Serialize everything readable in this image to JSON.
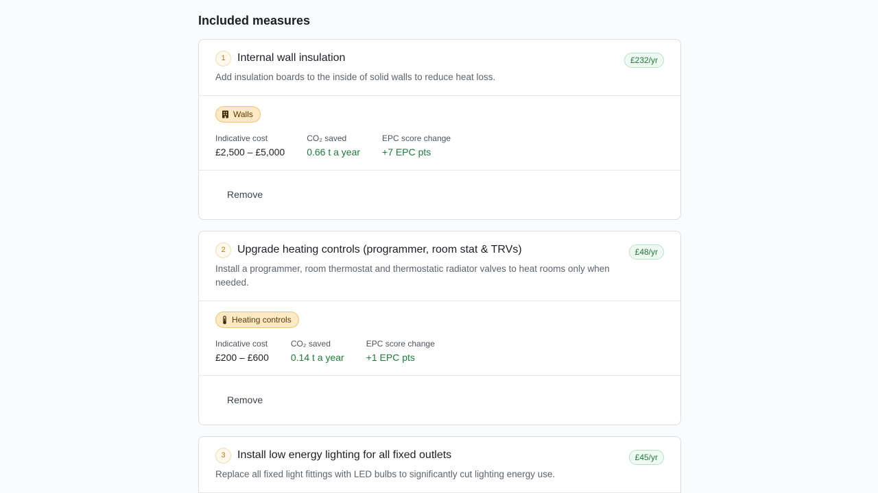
{
  "section": {
    "title": "Included measures"
  },
  "measures": [
    {
      "number": "1",
      "title": "Internal wall insulation",
      "description": "Add insulation boards to the inside of solid walls to reduce heat loss.",
      "savings": "£232/yr",
      "category": {
        "label": "Walls",
        "icon": "building-icon"
      },
      "metrics": {
        "cost_label": "Indicative cost",
        "cost_value": "£2,500 – £5,000",
        "co2_label": "CO₂ saved",
        "co2_value": "0.66 t a year",
        "epc_label": "EPC score change",
        "epc_value": "+7 EPC pts"
      },
      "remove_label": "Remove"
    },
    {
      "number": "2",
      "title": "Upgrade heating controls (programmer, room stat & TRVs)",
      "description": "Install a programmer, room thermostat and thermostatic radiator valves to heat rooms only when needed.",
      "savings": "£48/yr",
      "category": {
        "label": "Heating controls",
        "icon": "thermometer-icon"
      },
      "metrics": {
        "cost_label": "Indicative cost",
        "cost_value": "£200 – £600",
        "co2_label": "CO₂ saved",
        "co2_value": "0.14 t a year",
        "epc_label": "EPC score change",
        "epc_value": "+1 EPC pts"
      },
      "remove_label": "Remove"
    },
    {
      "number": "3",
      "title": "Install low energy lighting for all fixed outlets",
      "description": "Replace all fixed light fittings with LED bulbs to significantly cut lighting energy use.",
      "savings": "£45/yr"
    }
  ],
  "colors": {
    "accent_green": "#1f7a3a",
    "chip_amber": "#fde9c3",
    "number_amber": "#b77a10"
  }
}
